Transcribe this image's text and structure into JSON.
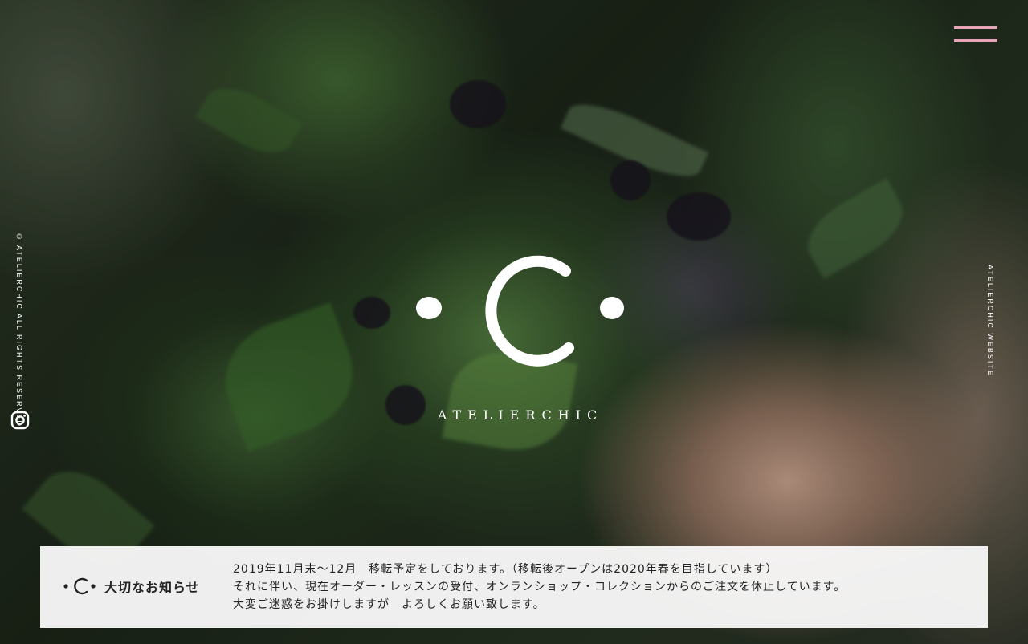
{
  "menu": {
    "icon": "hamburger-menu-icon",
    "color": "#e8a4b8"
  },
  "brand": {
    "name": "ATELIERCHIC"
  },
  "sidebar_left": {
    "copyright": "© ATELIERCHIC ALL RIGHTS RESERVED",
    "instagram_icon": "instagram-icon"
  },
  "sidebar_right": {
    "label": "ATELIERCHIC WEBSITE"
  },
  "notice": {
    "title": "大切なお知らせ",
    "lines": [
      "2019年11月末〜12月　移転予定をしております。（移転後オープンは2020年春を目指しています）",
      "それに伴い、現在オーダー・レッスンの受付、オンランショップ・コレクションからのご注文を休止しています。",
      "大変ご迷惑をお掛けしますが　よろしくお願い致します。"
    ]
  }
}
